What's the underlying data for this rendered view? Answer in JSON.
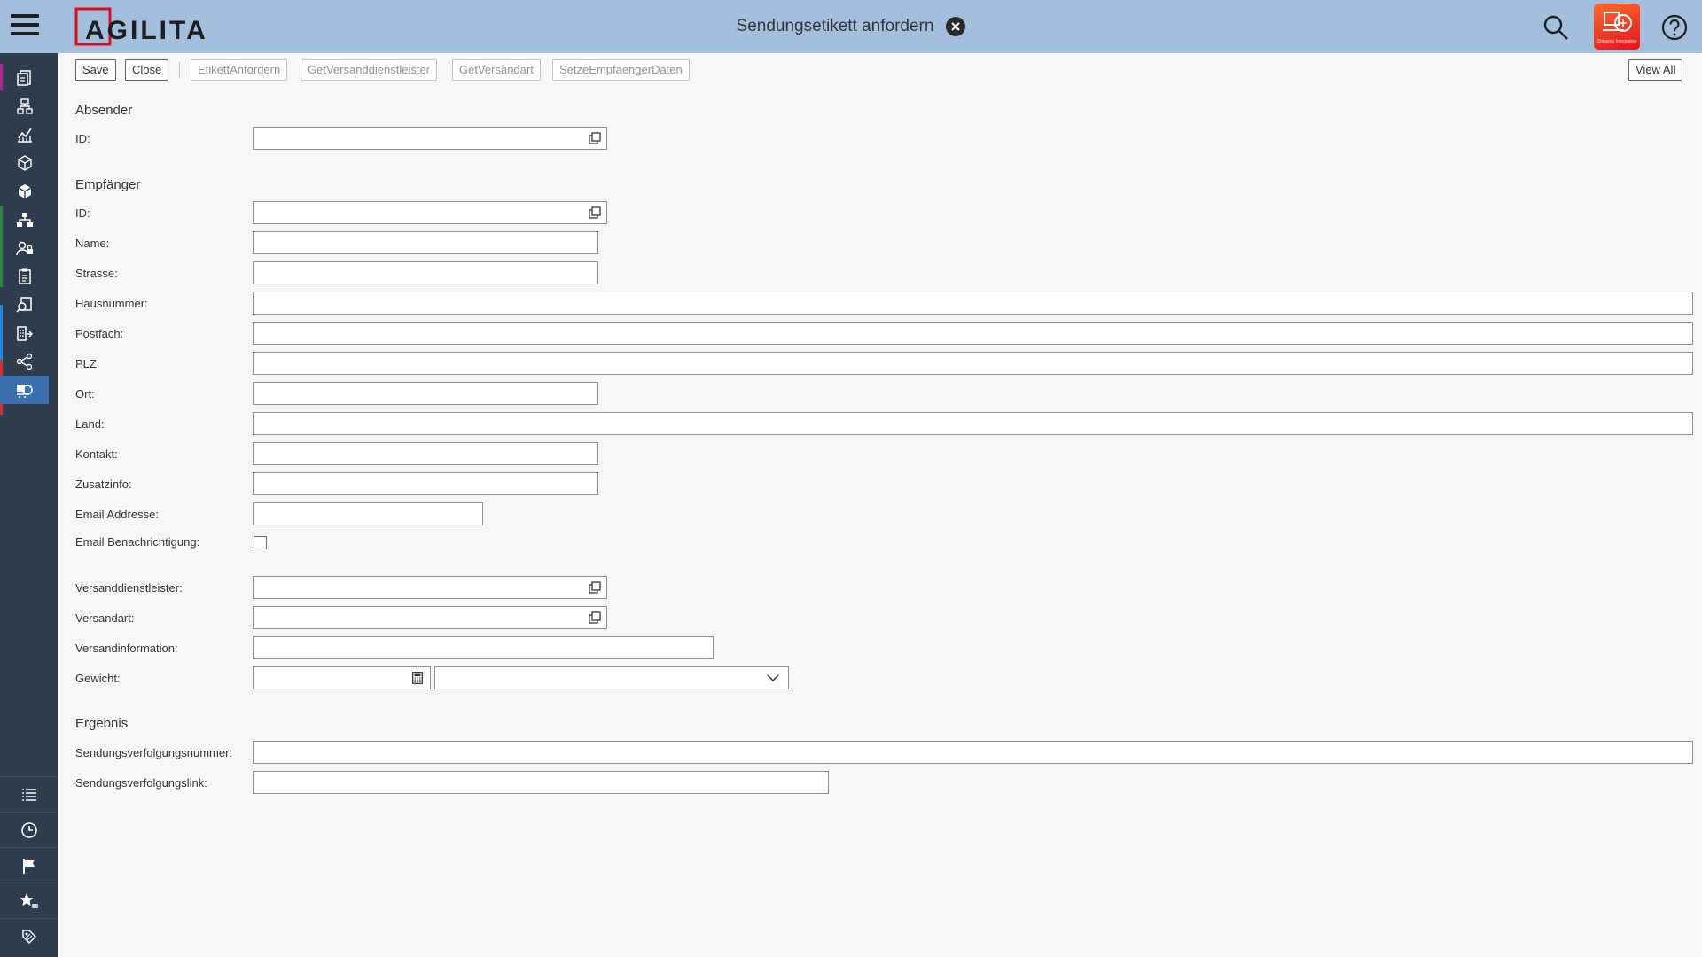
{
  "header": {
    "logo_text": "AGILITA",
    "title": "Sendungsetikett anfordern",
    "app_tile_text": "Shipping Integration",
    "icons": [
      "menu-icon",
      "search-icon",
      "help-icon",
      "close-circle-icon"
    ]
  },
  "toolbar": {
    "save": "Save",
    "close": "Close",
    "etikett": "EtikettAnfordern",
    "get_dienstleister": "GetVersanddienstleister",
    "get_versandart": "GetVersandart",
    "setze_empfaenger": "SetzeEmpfaengerDaten",
    "view_all": "View All"
  },
  "absender": {
    "title": "Absender",
    "id_label": "ID:",
    "id_value": ""
  },
  "empfaenger": {
    "title": "Empfänger",
    "id_label": "ID:",
    "name_label": "Name:",
    "strasse_label": "Strasse:",
    "hausnummer_label": "Hausnummer:",
    "postfach_label": "Postfach:",
    "plz_label": "PLZ:",
    "ort_label": "Ort:",
    "land_label": "Land:",
    "kontakt_label": "Kontakt:",
    "zusatzinfo_label": "Zusatzinfo:",
    "email_label": "Email Addresse:",
    "email_notify_label": "Email Benachrichtigung:",
    "email_notify_checked": false
  },
  "versand": {
    "dienstleister_label": "Versanddienstleister:",
    "versandart_label": "Versandart:",
    "versandinfo_label": "Versandinformation:",
    "gewicht_label": "Gewicht:",
    "gewicht_value": "",
    "gewicht_unit": ""
  },
  "ergebnis": {
    "title": "Ergebnis",
    "nummer_label": "Sendungsverfolgungsnummer:",
    "link_label": "Sendungsverfolgungslink:"
  },
  "colors": {
    "header_bg": "#a4bfdd",
    "sidebar_bg": "#2e3c4e",
    "sidebar_active": "#3b6fad",
    "brand_red": "#e3151f"
  }
}
